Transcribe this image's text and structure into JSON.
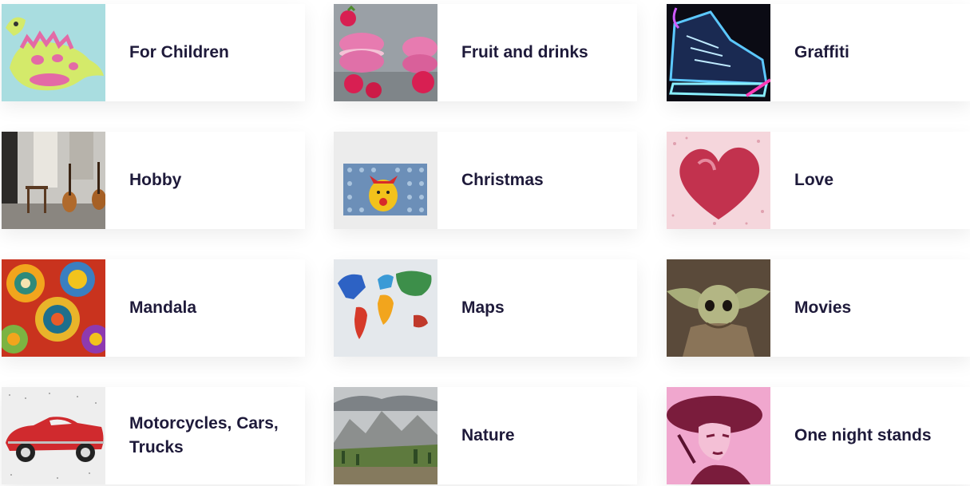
{
  "categories": [
    {
      "label": "For Children",
      "icon": "dinosaur-picture"
    },
    {
      "label": "Fruit and drinks",
      "icon": "macarons-picture"
    },
    {
      "label": "Graffiti",
      "icon": "neon-sneaker-picture"
    },
    {
      "label": "Hobby",
      "icon": "guitars-room-picture"
    },
    {
      "label": "Christmas",
      "icon": "reindeer-canvas-picture"
    },
    {
      "label": "Love",
      "icon": "heart-picture"
    },
    {
      "label": "Mandala",
      "icon": "mandala-picture"
    },
    {
      "label": "Maps",
      "icon": "world-map-picture"
    },
    {
      "label": "Movies",
      "icon": "baby-yoda-picture"
    },
    {
      "label": "Motorcycles, Cars, Trucks",
      "icon": "red-car-picture"
    },
    {
      "label": "Nature",
      "icon": "mountains-picture"
    },
    {
      "label": "One night stands",
      "icon": "woman-hat-picture"
    }
  ],
  "colors": {
    "text": "#1e1a3a",
    "card": "#ffffff"
  }
}
